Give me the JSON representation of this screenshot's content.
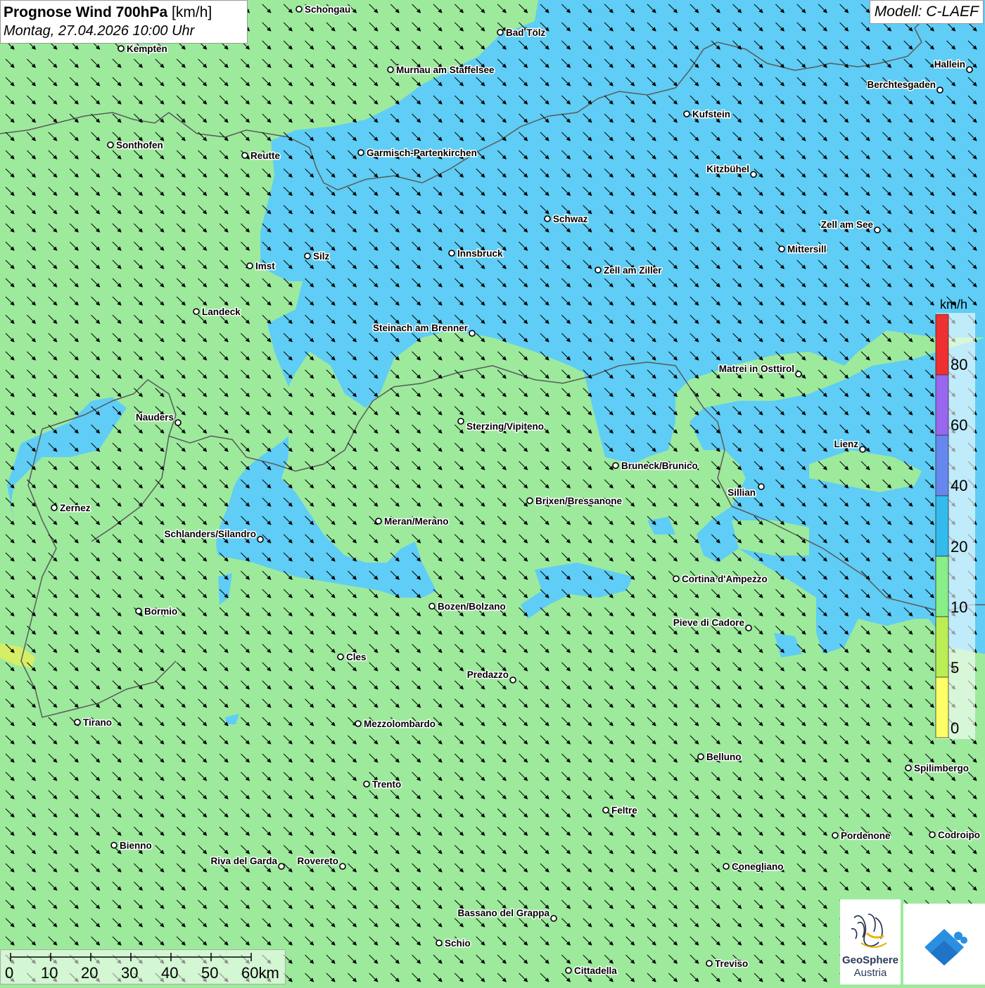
{
  "header": {
    "title_bold": "Prognose Wind 700hPa",
    "title_unit": "[km/h]",
    "subtitle": "Montag, 27.04.2026 10:00 Uhr",
    "model": "Modell: C-LAEF"
  },
  "legend": {
    "unit": "km/h",
    "ticks": [
      "80",
      "60",
      "40",
      "20",
      "10",
      "5",
      "0"
    ],
    "colors": [
      "#ee3030",
      "#9966ee",
      "#6688ee",
      "#33bbee",
      "#88ee88",
      "#bbee55",
      "#ffff66"
    ]
  },
  "colors": {
    "low_wind": "#9dea9d",
    "mid_wind": "#5fcdf5",
    "border": "#5a5a5a",
    "arrow": "#000000"
  },
  "wind_direction_deg": 135,
  "cities": [
    "Schongau",
    "Kempten",
    "Bad Tölz",
    "Murnau am Staffelsee",
    "Hallein",
    "Berchtesgaden",
    "Kufstein",
    "Sonthofen",
    "Reutte",
    "Garmisch-Partenkirchen",
    "Kitzbühel",
    "Schwaz",
    "Zell am See",
    "Mittersill",
    "Innsbruck",
    "Silz",
    "Imst",
    "Zell am Ziller",
    "Landeck",
    "Steinach am Brenner",
    "Matrei in Osttirol",
    "Nauders",
    "Sterzing/Vipiteno",
    "Lienz",
    "Bruneck/Brunico",
    "Sillian",
    "Zernez",
    "Brixen/Bressanone",
    "Meran/Merano",
    "Schlanders/Silandro",
    "Cortina d'Ampezzo",
    "Bozen/Bolzano",
    "Bormio",
    "Pieve di Cadore",
    "Cles",
    "Predazzo",
    "Tirano",
    "Mezzolombardo",
    "Belluno",
    "Spilimbergo",
    "Trento",
    "Feltre",
    "Pordenone",
    "Codroipo",
    "Bienno",
    "Riva del Garda",
    "Rovereto",
    "Conegliano",
    "Bassano del Grappa",
    "Schio",
    "Treviso",
    "Cittadella"
  ],
  "scale": {
    "labels": [
      "0",
      "10",
      "20",
      "30",
      "40",
      "50",
      "60km"
    ]
  },
  "logos": {
    "geosphere_line1": "GeoSphere",
    "geosphere_line2": "Austria"
  }
}
